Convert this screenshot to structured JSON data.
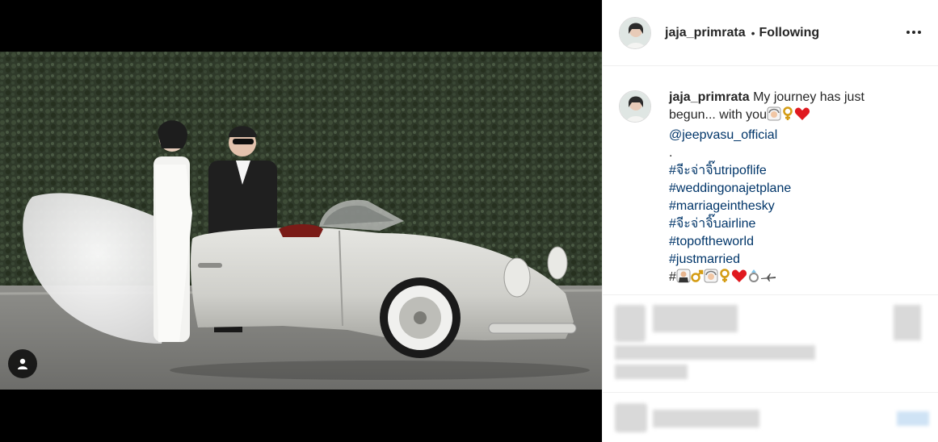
{
  "post": {
    "username": "jaja_primrata",
    "separator": "•",
    "follow_status": "Following",
    "more_icon": "more-horizontal-icon"
  },
  "caption": {
    "username": "jaja_primrata",
    "text": "My journey has just begun... with you",
    "mention": "@jeepvasu_official",
    "dot": ".",
    "hashtags": [
      "#จีะจ่าจิ๊บtripoflife",
      "#weddingonajetplane",
      "#marriageinthesky",
      "#จีะจ่าจิ๊บairline",
      "#topoftheworld",
      "#justmarried"
    ],
    "last_line_prefix": "#"
  },
  "media": {
    "tag_icon": "user-tag-icon"
  },
  "colors": {
    "link": "#003569",
    "text": "#262626",
    "border": "#efefef"
  }
}
